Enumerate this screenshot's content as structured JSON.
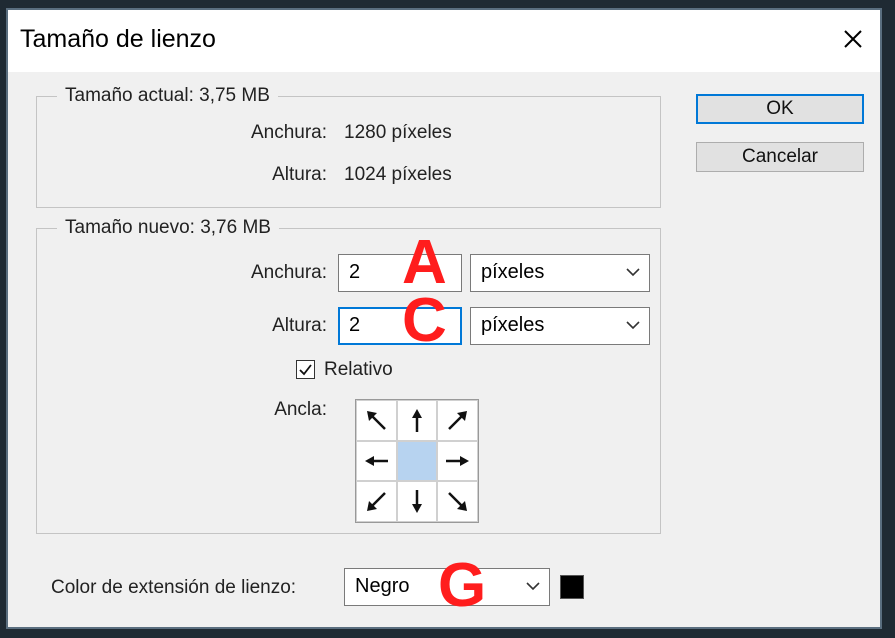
{
  "dialog": {
    "title": "Tamaño de lienzo"
  },
  "current_size": {
    "legend": "Tamaño actual: 3,75 MB",
    "width_label": "Anchura:",
    "width_value": "1280 píxeles",
    "height_label": "Altura:",
    "height_value": "1024 píxeles"
  },
  "new_size": {
    "legend": "Tamaño nuevo: 3,76 MB",
    "width_label": "Anchura:",
    "width_value": "2",
    "width_unit": "píxeles",
    "height_label": "Altura:",
    "height_value": "2",
    "height_unit": "píxeles",
    "relative_label": "Relativo",
    "relative_checked": true,
    "anchor_label": "Ancla:",
    "anchor_selected": "center"
  },
  "extension": {
    "label": "Color de extensión de lienzo:",
    "value": "Negro",
    "swatch_color": "#000000"
  },
  "buttons": {
    "ok": "OK",
    "cancel": "Cancelar"
  },
  "annotations": {
    "a": "A",
    "c": "C",
    "g": "G"
  },
  "colors": {
    "accent": "#0078d7",
    "annotation": "#ff1d1d",
    "anchor_center": "#b7d3f0"
  }
}
